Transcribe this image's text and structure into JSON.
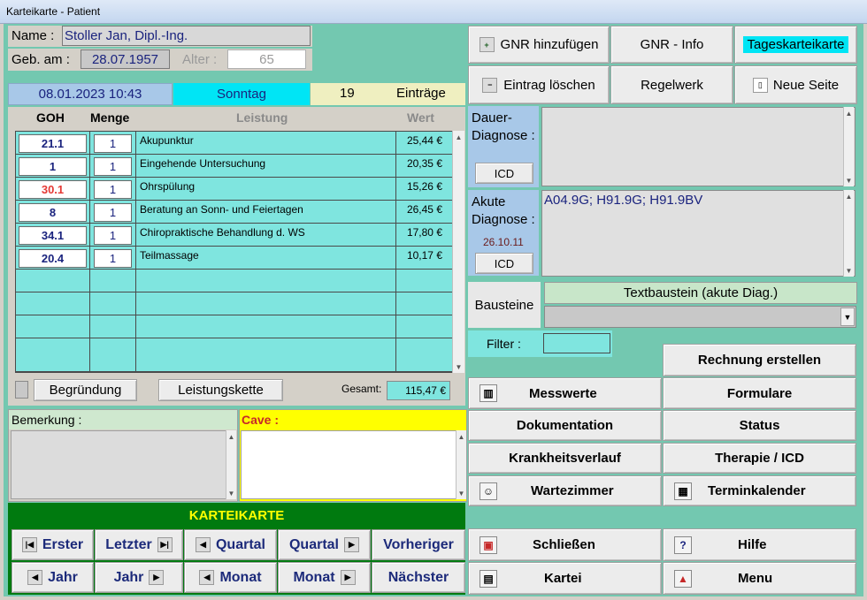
{
  "window": {
    "title": "Karteikarte - Patient"
  },
  "patient": {
    "name_label": "Name :",
    "name_value": "Stoller Jan, Dipl.-Ing.",
    "dob_label": "Geb. am :",
    "dob_value": "28.07.1957",
    "age_label": "Alter :",
    "age_value": "65"
  },
  "date_bar": {
    "datetime": "08.01.2023 10:43",
    "weekday": "Sonntag",
    "count": "19",
    "entries_label": "Einträge"
  },
  "table": {
    "headers": {
      "goh": "GOH",
      "menge": "Menge",
      "leistung": "Leistung",
      "wert": "Wert"
    },
    "rows": [
      {
        "goh": "21.1",
        "menge": "1",
        "leistung": "Akupunktur",
        "wert": "25,44 €",
        "goh_color": "#1a237e"
      },
      {
        "goh": "1",
        "menge": "1",
        "leistung": "Eingehende Untersuchung",
        "wert": "20,35 €",
        "goh_color": "#1a237e"
      },
      {
        "goh": "30.1",
        "menge": "1",
        "leistung": "Ohrspülung",
        "wert": "15,26 €",
        "goh_color": "#e53935"
      },
      {
        "goh": "8",
        "menge": "1",
        "leistung": "Beratung an Sonn- und Feiertagen",
        "wert": "26,45 €",
        "goh_color": "#1a237e"
      },
      {
        "goh": "34.1",
        "menge": "1",
        "leistung": "Chiropraktische Behandlung d. WS",
        "wert": "17,80 €",
        "goh_color": "#1a237e"
      },
      {
        "goh": "20.4",
        "menge": "1",
        "leistung": "Teilmassage",
        "wert": "10,17 €",
        "goh_color": "#1a237e"
      }
    ],
    "total_label": "Gesamt:",
    "total_value": "115,47 €"
  },
  "buttons_left": {
    "begruendung": "Begründung",
    "leistungskette": "Leistungskette"
  },
  "notes": {
    "bemerkung_label": "Bemerkung :",
    "cave_label": "Cave :"
  },
  "nav": {
    "header": "KARTEIKARTE",
    "row1": [
      "Erster",
      "Letzter",
      "Quartal",
      "Quartal",
      "Vorheriger"
    ],
    "row2": [
      "Jahr",
      "Jahr",
      "Monat",
      "Monat",
      "Nächster"
    ]
  },
  "top_buttons": {
    "gnr_add": "GNR hinzufügen",
    "gnr_info": "GNR - Info",
    "tageskarteikarte": "Tageskarteikarte",
    "eintrag_loeschen": "Eintrag löschen",
    "regelwerk": "Regelwerk",
    "neue_seite": "Neue Seite"
  },
  "diagnosis": {
    "dauer_label": "Dauer-\nDiagnose :",
    "dauer_icd": "ICD",
    "akut_label": "Akute\nDiagnose :",
    "akut_date": "26.10.11",
    "akut_icd": "ICD",
    "akut_value": "A04.9G; H91.9G; H91.9BV",
    "bausteine_label": "Bausteine",
    "textbaustein": "Textbaustein (akute Diag.)",
    "filter_label": "Filter :"
  },
  "action_buttons": {
    "rechnung": "Rechnung erstellen",
    "messwerte": "Messwerte",
    "formulare": "Formulare",
    "dokumentation": "Dokumentation",
    "status": "Status",
    "krankheitsverlauf": "Krankheitsverlauf",
    "therapie": "Therapie / ICD",
    "wartezimmer": "Wartezimmer",
    "terminkalender": "Terminkalender",
    "schliessen": "Schließen",
    "hilfe": "Hilfe",
    "kartei": "Kartei",
    "menu": "Menu"
  },
  "colors": {
    "teal_bg": "#73c8b0",
    "grid_bg": "#7fe5df",
    "nav_green": "#007a0f",
    "cave_yellow": "#ffff00",
    "bemerkung_green": "#cfe8cf"
  }
}
